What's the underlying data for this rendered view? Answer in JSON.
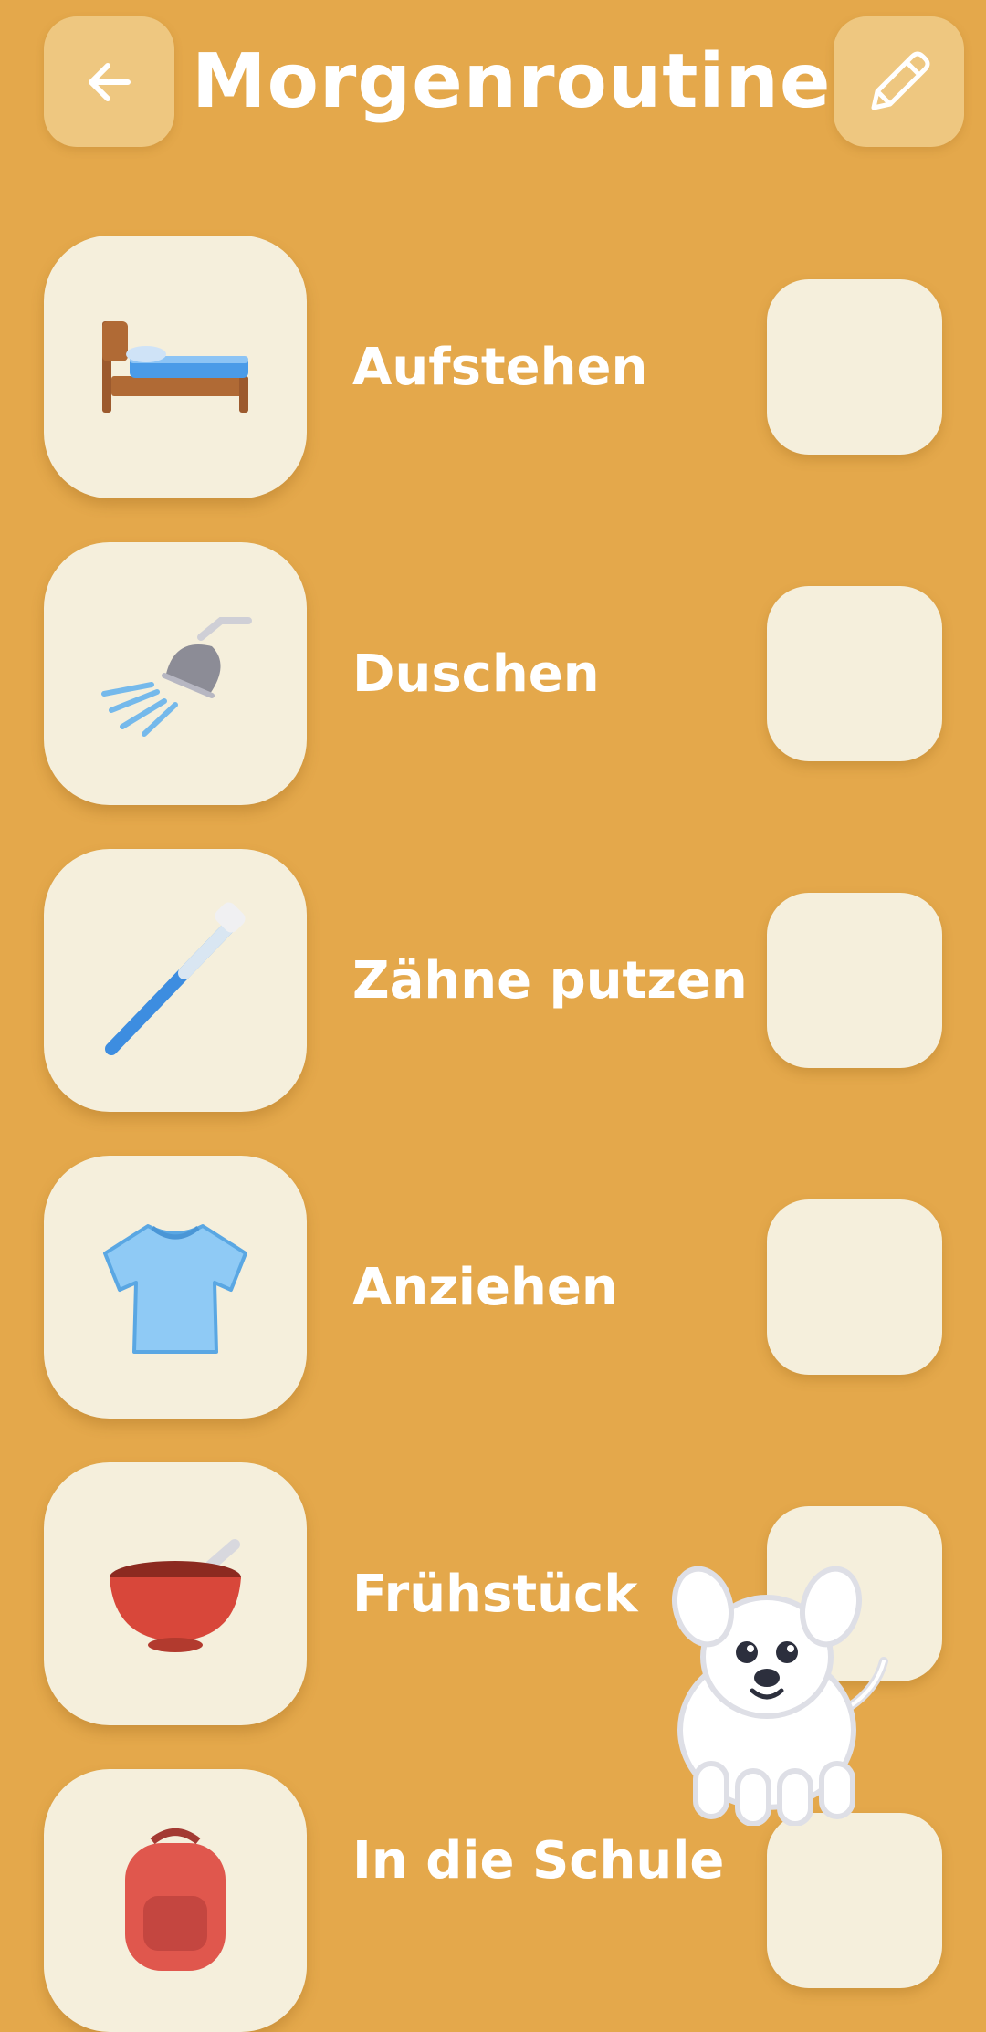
{
  "header": {
    "title": "Morgenroutine",
    "back_icon": "arrow-left-icon",
    "edit_icon": "pencil-icon"
  },
  "steps": [
    {
      "label": "Aufstehen",
      "icon": "bed-icon",
      "done": false
    },
    {
      "label": "Duschen",
      "icon": "shower-icon",
      "done": false
    },
    {
      "label": "Zähne putzen",
      "icon": "toothbrush-icon",
      "done": false
    },
    {
      "label": "Anziehen",
      "icon": "tshirt-icon",
      "done": false
    },
    {
      "label": "Frühstück",
      "icon": "bowl-icon",
      "done": false
    },
    {
      "label": "In die Schule",
      "icon": "backpack-icon",
      "done": false
    }
  ],
  "mascot": {
    "icon": "dog-mascot-icon"
  },
  "colors": {
    "background": "#e4a84b",
    "tile": "#f5efdc",
    "header_button": "#eec780",
    "text": "#ffffff"
  }
}
